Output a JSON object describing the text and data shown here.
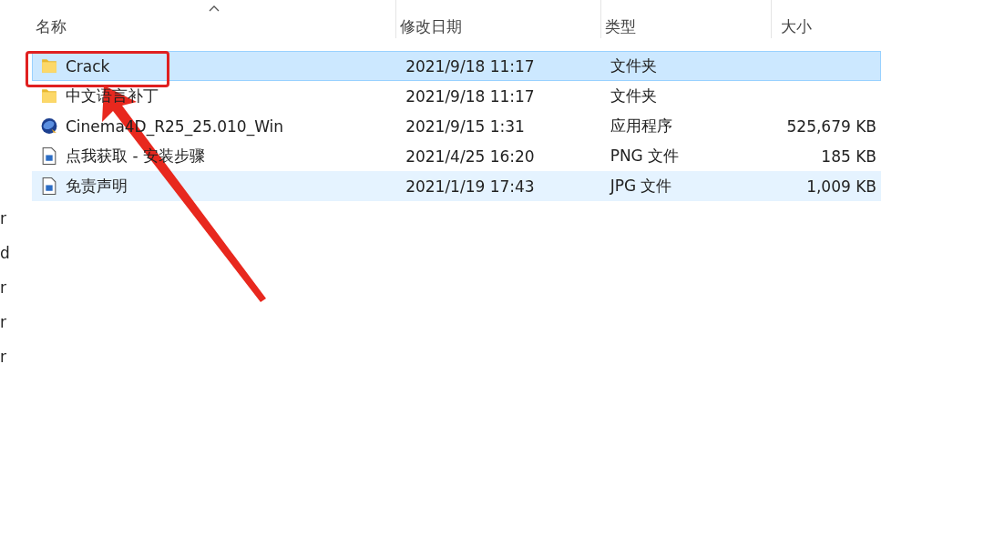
{
  "nav_pane": {
    "items": [
      {
        "label": "r"
      },
      {
        "label": "d"
      },
      {
        "label": "r"
      },
      {
        "label": "r"
      },
      {
        "label": "r"
      }
    ]
  },
  "file_list": {
    "columns": [
      {
        "label": "名称",
        "sorted": true
      },
      {
        "label": "修改日期",
        "sorted": false
      },
      {
        "label": "类型",
        "sorted": false
      },
      {
        "label": "大小",
        "sorted": false
      }
    ],
    "rows": [
      {
        "kind": "folder",
        "name": "Crack",
        "date": "2021/9/18 11:17",
        "type": "文件夹",
        "size": "",
        "selected": true,
        "hovered": false,
        "highlighted": true
      },
      {
        "kind": "folder",
        "name": "中文语言补丁",
        "date": "2021/9/18 11:17",
        "type": "文件夹",
        "size": "",
        "selected": false,
        "hovered": false,
        "highlighted": false
      },
      {
        "kind": "app",
        "name": "Cinema4D_R25_25.010_Win",
        "date": "2021/9/15 1:31",
        "type": "应用程序",
        "size": "525,679 KB",
        "selected": false,
        "hovered": false,
        "highlighted": false
      },
      {
        "kind": "image",
        "name": "点我获取 - 安装步骤",
        "date": "2021/4/25 16:20",
        "type": "PNG 文件",
        "size": "185 KB",
        "selected": false,
        "hovered": false,
        "highlighted": false
      },
      {
        "kind": "image",
        "name": "免责声明",
        "date": "2021/1/19 17:43",
        "type": "JPG 文件",
        "size": "1,009 KB",
        "selected": false,
        "hovered": true,
        "highlighted": false
      }
    ]
  },
  "annotation": {
    "kind": "arrow"
  }
}
